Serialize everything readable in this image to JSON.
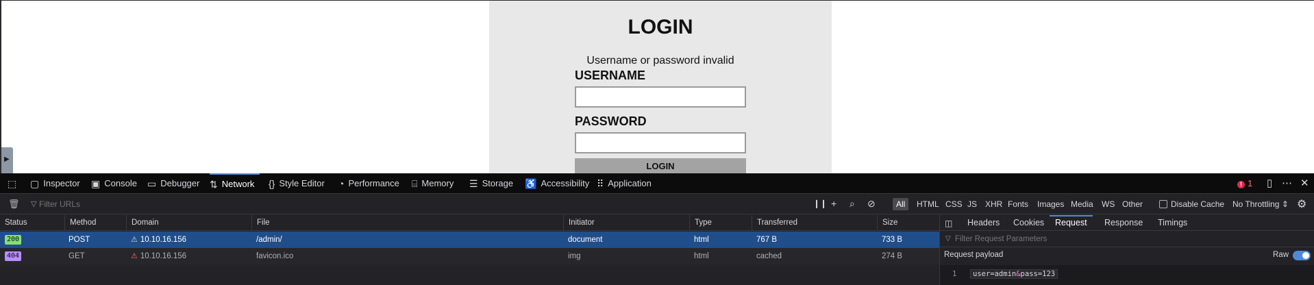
{
  "login": {
    "title": "LOGIN",
    "error": "Username or password invalid",
    "username_label": "USERNAME",
    "password_label": "PASSWORD",
    "button": "LOGIN"
  },
  "devtools": {
    "tabs": [
      {
        "label": "Inspector",
        "icon": "inspector-icon"
      },
      {
        "label": "Console",
        "icon": "console-icon"
      },
      {
        "label": "Debugger",
        "icon": "debugger-icon"
      },
      {
        "label": "Network",
        "icon": "network-icon"
      },
      {
        "label": "Style Editor",
        "icon": "style-editor-icon"
      },
      {
        "label": "Performance",
        "icon": "performance-icon"
      },
      {
        "label": "Memory",
        "icon": "memory-icon"
      },
      {
        "label": "Storage",
        "icon": "storage-icon"
      },
      {
        "label": "Accessibility",
        "icon": "accessibility-icon"
      },
      {
        "label": "Application",
        "icon": "application-icon"
      }
    ],
    "active_tab": "Network",
    "error_count": "1",
    "filter_placeholder": "Filter URLs",
    "type_filters": [
      "All",
      "HTML",
      "CSS",
      "JS",
      "XHR",
      "Fonts",
      "Images",
      "Media",
      "WS",
      "Other"
    ],
    "active_type_filter": "All",
    "disable_cache_label": "Disable Cache",
    "throttling_label": "No Throttling ⇕",
    "columns": [
      "Status",
      "Method",
      "Domain",
      "File",
      "Initiator",
      "Type",
      "Transferred",
      "Size"
    ],
    "requests": [
      {
        "status": "200",
        "method": "POST",
        "domain": "10.10.16.156",
        "file": "/admin/",
        "initiator": "document",
        "type": "html",
        "transferred": "767 B",
        "size": "733 B"
      },
      {
        "status": "404",
        "method": "GET",
        "domain": "10.10.16.156",
        "file": "favicon.ico",
        "initiator": "img",
        "type": "html",
        "transferred": "cached",
        "size": "274 B"
      }
    ],
    "side_panel": {
      "tabs": [
        "Headers",
        "Cookies",
        "Request",
        "Response",
        "Timings"
      ],
      "active_tab": "Request",
      "filter_placeholder": "Filter Request Parameters",
      "payload_title": "Request payload",
      "raw_label": "Raw",
      "raw_enabled": true,
      "line_number": "1",
      "payload": {
        "part1": "user=admin",
        "amp": "&",
        "part2": "pass=123"
      }
    }
  },
  "colors": {
    "accent": "#4d8bd9",
    "selected_row": "#204e8a",
    "status_200": "#86de74",
    "status_404": "#b98eff",
    "error_red": "#e22850"
  }
}
